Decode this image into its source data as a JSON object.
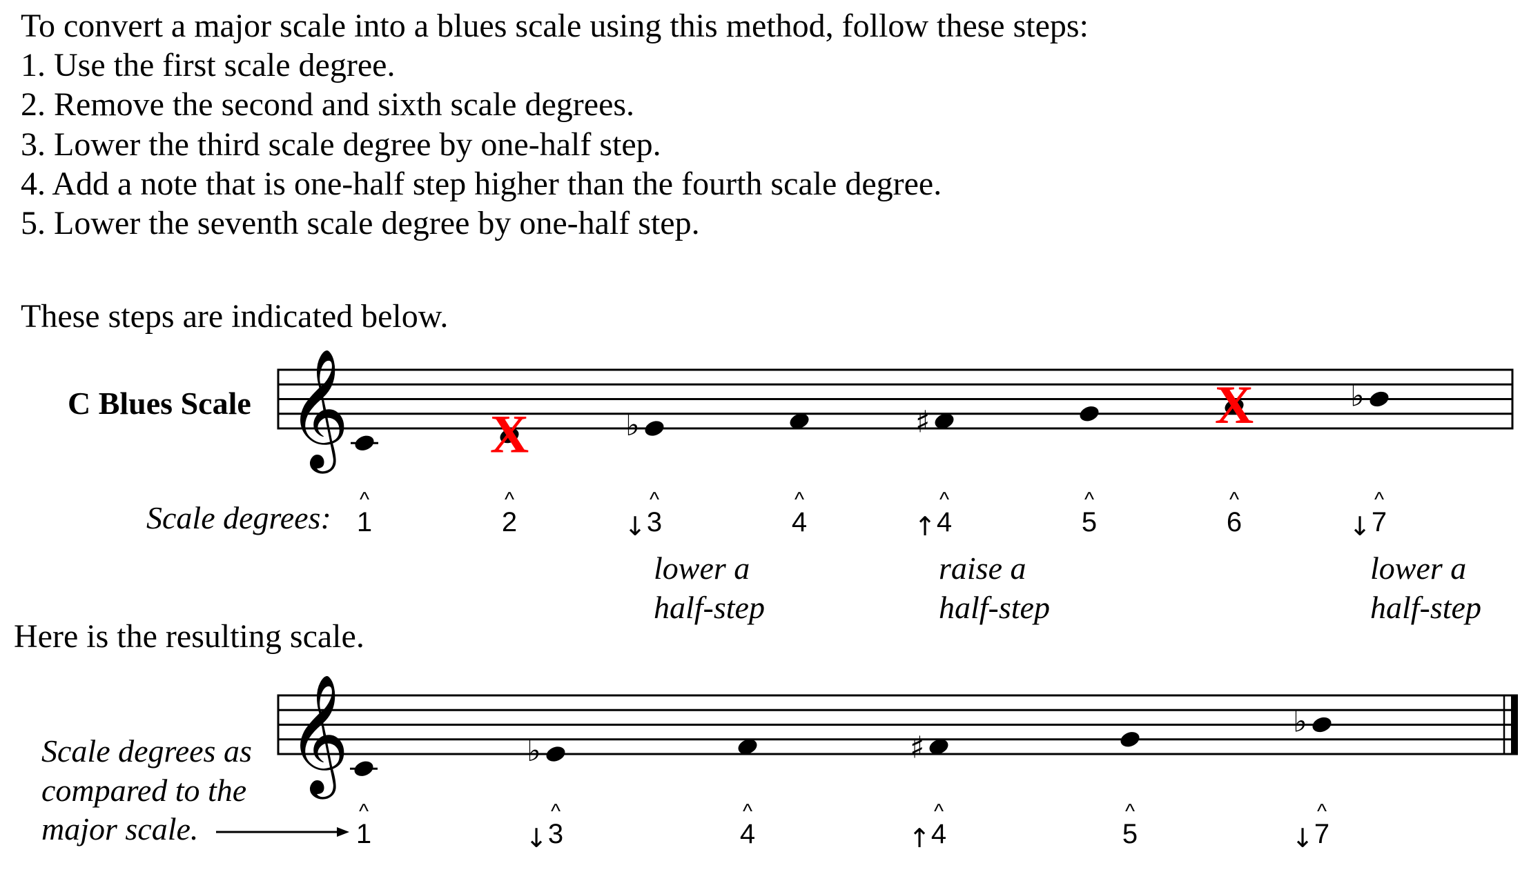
{
  "intro": {
    "heading": "To convert a major scale into a blues scale using this method, follow these steps:",
    "steps": [
      "1. Use the first scale degree.",
      "2. Remove the second and sixth scale degrees.",
      "3. Lower the third scale degree by one-half step.",
      "4. Add a note that is one-half step higher than the fourth scale degree.",
      "5. Lower the seventh scale degree by one-half step."
    ],
    "indicated": "These steps are indicated below."
  },
  "staff1": {
    "title": "C Blues Scale",
    "clef": "treble",
    "degrees_label": "Scale degrees:",
    "notes": [
      {
        "pitch": "C4",
        "accidental": "",
        "removed": false,
        "degree": "1",
        "mod": ""
      },
      {
        "pitch": "D4",
        "accidental": "",
        "removed": true,
        "degree": "2",
        "mod": ""
      },
      {
        "pitch": "E4",
        "accidental": "flat",
        "removed": false,
        "degree": "3",
        "mod": "down"
      },
      {
        "pitch": "F4",
        "accidental": "",
        "removed": false,
        "degree": "4",
        "mod": ""
      },
      {
        "pitch": "F4",
        "accidental": "sharp",
        "removed": false,
        "degree": "4",
        "mod": "up"
      },
      {
        "pitch": "G4",
        "accidental": "",
        "removed": false,
        "degree": "5",
        "mod": ""
      },
      {
        "pitch": "A4",
        "accidental": "",
        "removed": true,
        "degree": "6",
        "mod": ""
      },
      {
        "pitch": "B4",
        "accidental": "flat",
        "removed": false,
        "degree": "7",
        "mod": "down"
      }
    ],
    "removed_mark": "X",
    "removed_color": "#ff0000",
    "annotations": [
      {
        "note_index": 2,
        "line1": "lower a",
        "line2": "half-step"
      },
      {
        "note_index": 4,
        "line1": "raise a",
        "line2": "half-step"
      },
      {
        "note_index": 7,
        "line1": "lower a",
        "line2": "half-step"
      }
    ]
  },
  "result_text": "Here is the resulting scale.",
  "staff2": {
    "clef": "treble",
    "side_label": [
      "Scale degrees as",
      "compared to the",
      "major scale."
    ],
    "final_barline": true,
    "notes": [
      {
        "pitch": "C4",
        "accidental": "",
        "degree": "1",
        "mod": ""
      },
      {
        "pitch": "E4",
        "accidental": "flat",
        "degree": "3",
        "mod": "down"
      },
      {
        "pitch": "F4",
        "accidental": "",
        "degree": "4",
        "mod": ""
      },
      {
        "pitch": "F4",
        "accidental": "sharp",
        "degree": "4",
        "mod": "up"
      },
      {
        "pitch": "G4",
        "accidental": "",
        "degree": "5",
        "mod": ""
      },
      {
        "pitch": "B4",
        "accidental": "flat",
        "degree": "7",
        "mod": "down"
      }
    ]
  },
  "symbols": {
    "caret": "^",
    "down_arrow": "↓",
    "up_arrow": "↑",
    "flat": "♭",
    "sharp": "♯",
    "treble_clef": "𝄞"
  }
}
